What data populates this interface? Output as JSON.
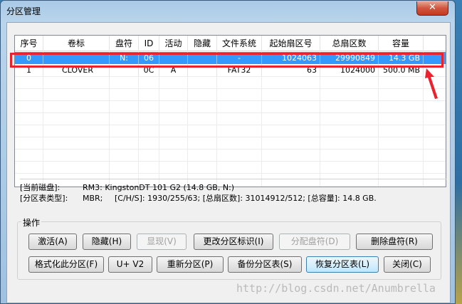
{
  "window": {
    "title": "分区管理",
    "close_symbol": "✕"
  },
  "table": {
    "columns": [
      "序号",
      "卷标",
      "盘符",
      "ID",
      "活动",
      "隐藏",
      "文件系统",
      "起始扇区号",
      "总扇区数",
      "容量"
    ],
    "rows": [
      {
        "index": "0",
        "label": "",
        "drive": "N:",
        "id": "06",
        "active": "",
        "hidden": "",
        "fs": "-",
        "start": "1024063",
        "total": "29990849",
        "size": "14.3 GB",
        "selected": true
      },
      {
        "index": "1",
        "label": "CLOVER",
        "drive": "",
        "id": "0C",
        "active": "A",
        "hidden": "",
        "fs": "FAT32",
        "start": "63",
        "total": "1024000",
        "size": "500.0 MB",
        "selected": false
      }
    ]
  },
  "info": {
    "disk_label": "[当前磁盘]:",
    "disk_value": "RM3: KingstonDT 101 G2 (14.8 GB, N:)",
    "type_label": "[分区表类型]:",
    "type_value": "MBR;",
    "chs": "[C/H/S]: 1930/255/63; [总扇区数]: 31014912/512; [总容量]: 14.8 GB."
  },
  "ops": {
    "group_title": "操作",
    "buttons": {
      "activate": "激活(A)",
      "hide": "隐藏(H)",
      "show": "显现(V)",
      "change_id": "更改分区标识(I)",
      "assign_drive": "分配盘符(D)",
      "delete_drive": "删除盘符(R)",
      "format": "格式化此分区(F)",
      "uplus": "U+ V2",
      "repartition": "重新分区(P)",
      "backup": "备份分区表(S)",
      "restore": "恢复分区表(L)",
      "close": "关闭(C)"
    }
  },
  "watermark": "http://blog.csdn.net/Anumbrella",
  "colors": {
    "selection": "#3399ff",
    "highlight_box": "#e8232e",
    "arrow": "#e8232e"
  }
}
